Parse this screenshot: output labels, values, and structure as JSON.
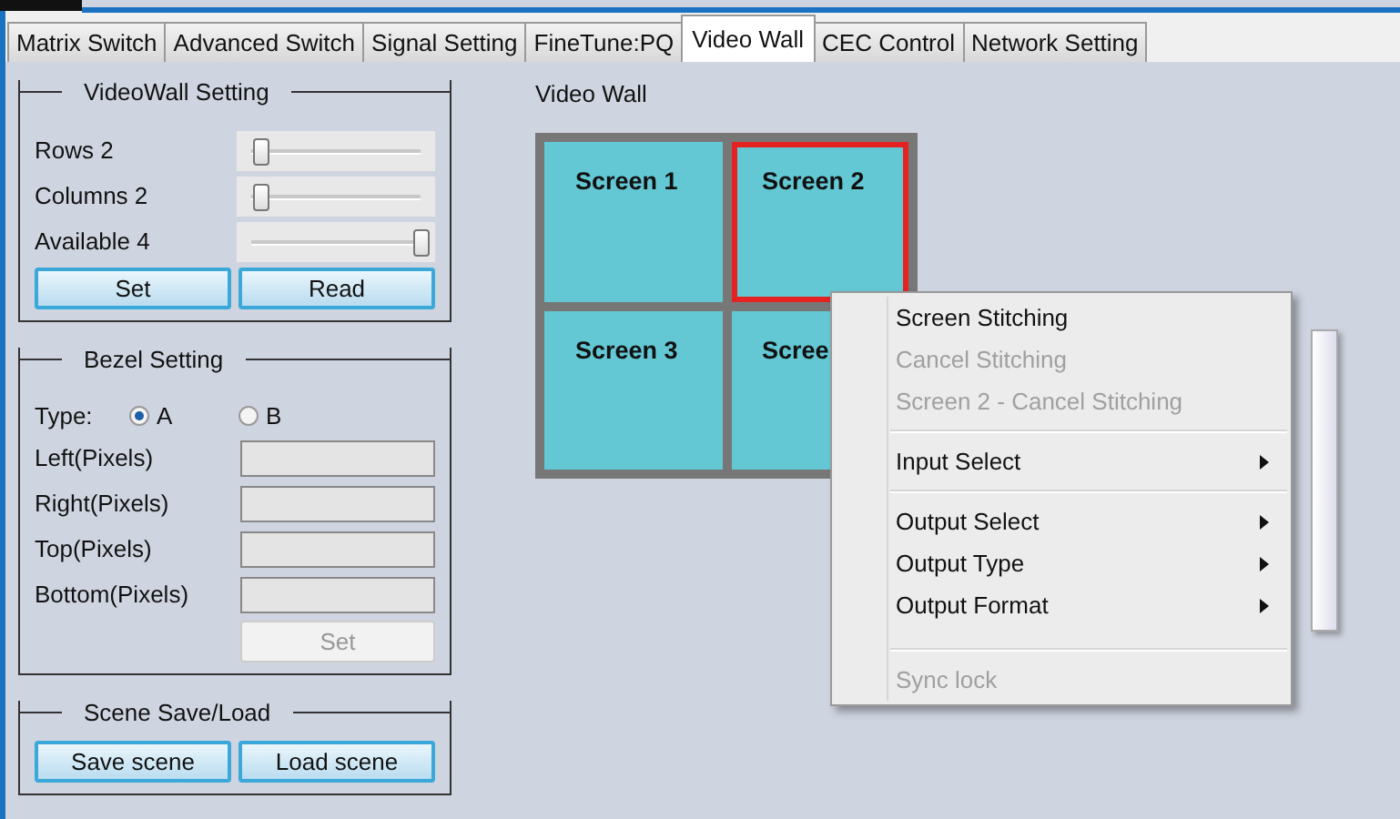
{
  "tabs": [
    {
      "label": "Matrix Switch",
      "selected": false
    },
    {
      "label": "Advanced Switch",
      "selected": false
    },
    {
      "label": "Signal Setting",
      "selected": false
    },
    {
      "label": "FineTune:PQ",
      "selected": false
    },
    {
      "label": "Video Wall",
      "selected": true
    },
    {
      "label": "CEC Control",
      "selected": false
    },
    {
      "label": "Network Setting",
      "selected": false
    }
  ],
  "videowall_setting": {
    "title": "VideoWall Setting",
    "sliders": [
      {
        "label": "Rows 2",
        "level": 0.05
      },
      {
        "label": "Columns 2",
        "level": 0.05
      },
      {
        "label": "Available 4",
        "level": 1
      }
    ],
    "buttons": [
      {
        "label": "Set",
        "disabled": false
      },
      {
        "label": "Read",
        "disabled": false
      }
    ]
  },
  "bezel_setting": {
    "title": "Bezel Setting",
    "type_label": "Type:",
    "type_options": [
      {
        "label": "A",
        "selected": true
      },
      {
        "label": "B",
        "selected": false
      }
    ],
    "fields": [
      {
        "label": "Left(Pixels)"
      },
      {
        "label": "Right(Pixels)"
      },
      {
        "label": "Top(Pixels)"
      },
      {
        "label": "Bottom(Pixels)"
      }
    ],
    "button": {
      "label": "Set",
      "disabled": true
    }
  },
  "scene": {
    "title": "Scene Save/Load",
    "buttons": [
      {
        "label": "Save scene",
        "disabled": false
      },
      {
        "label": "Load scene",
        "disabled": false
      }
    ]
  },
  "video_wall": {
    "title": "Video Wall",
    "screens": [
      {
        "label": "Screen 1",
        "selected": false
      },
      {
        "label": "Screen 2",
        "selected": true
      },
      {
        "label": "Screen 3",
        "selected": false
      },
      {
        "label": "Scree",
        "selected": false
      }
    ]
  },
  "context_menu": {
    "items": [
      {
        "kind": "item",
        "label": "Screen Stitching",
        "disabled": false,
        "submenu": false
      },
      {
        "kind": "item",
        "label": "Cancel Stitching",
        "disabled": true,
        "submenu": false
      },
      {
        "kind": "item",
        "label": "Screen 2 - Cancel Stitching",
        "disabled": true,
        "submenu": false
      },
      {
        "kind": "separator"
      },
      {
        "kind": "item",
        "label": "Input Select",
        "disabled": false,
        "submenu": true
      },
      {
        "kind": "separator"
      },
      {
        "kind": "item",
        "label": "Output Select",
        "disabled": false,
        "submenu": true
      },
      {
        "kind": "item",
        "label": "Output Type",
        "disabled": false,
        "submenu": true
      },
      {
        "kind": "item",
        "label": "Output Format",
        "disabled": false,
        "submenu": true
      },
      {
        "kind": "separator"
      },
      {
        "kind": "item",
        "label": "Sync lock",
        "disabled": true,
        "submenu": false
      }
    ]
  }
}
